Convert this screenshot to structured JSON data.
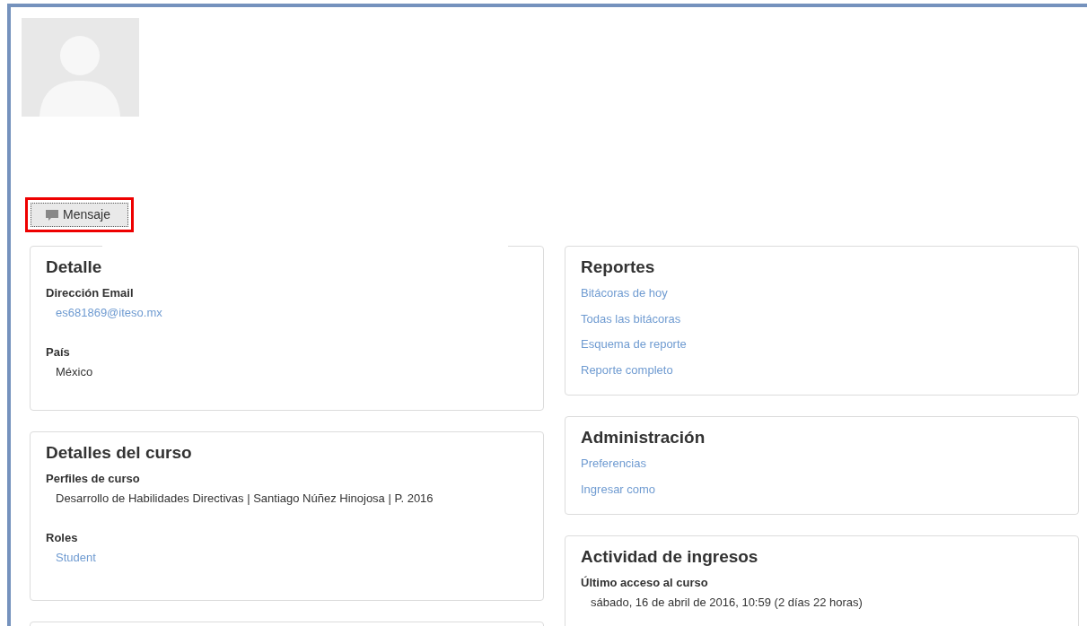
{
  "profile": {
    "message_button": {
      "label": "Mensaje",
      "highlighted": true
    }
  },
  "left_cards": [
    {
      "title": "Detalle",
      "fields": [
        {
          "label": "Dirección Email",
          "value": "es681869@iteso.mx",
          "link": true
        },
        {
          "label": "País",
          "value": "México",
          "link": false
        }
      ]
    },
    {
      "title": "Detalles del curso",
      "fields": [
        {
          "label": "Perfiles de curso",
          "value": "Desarrollo de Habilidades Directivas | Santiago Núñez Hinojosa | P. 2016",
          "link": false
        },
        {
          "label": "Roles",
          "value": "Student",
          "link": true
        }
      ]
    }
  ],
  "right_cards": [
    {
      "title": "Reportes",
      "kind": "links",
      "links": [
        "Bitácoras de hoy",
        "Todas las bitácoras",
        "Esquema de reporte",
        "Reporte completo"
      ]
    },
    {
      "title": "Administración",
      "kind": "links",
      "links": [
        "Preferencias",
        "Ingresar como"
      ]
    },
    {
      "title": "Actividad de ingresos",
      "kind": "fields",
      "fields": [
        {
          "label": "Último acceso al curso",
          "value": "sábado, 16 de abril de 2016, 10:59  (2 días 22 horas)"
        }
      ]
    }
  ]
}
